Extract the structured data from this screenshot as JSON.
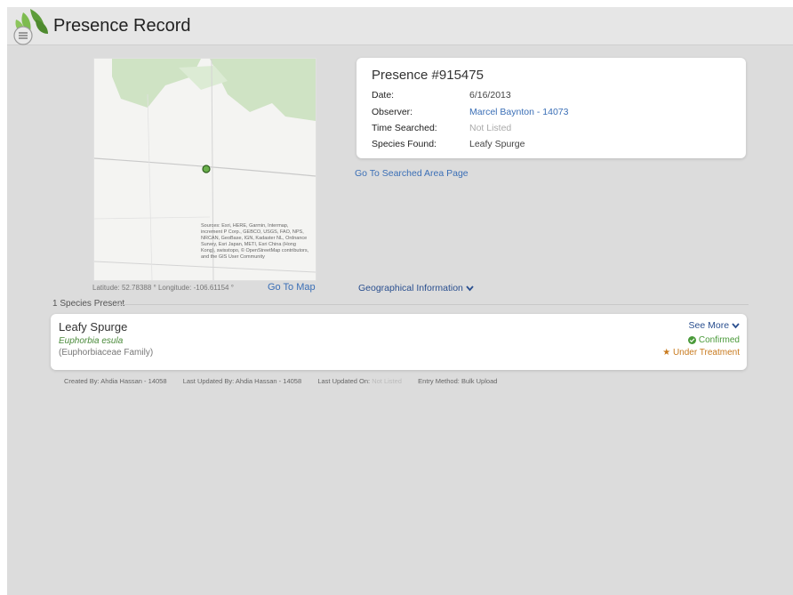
{
  "header": {
    "title": "Presence Record",
    "logo": "leaf-menu-icon"
  },
  "map": {
    "attribution": "Sources: Esri, HERE, Garmin, Intermap, increment P Corp., GEBCO, USGS, FAO, NPS, NRCAN, GeoBase, IGN, Kadaster NL, Ordnance Survey, Esri Japan, METI, Esri China (Hong Kong), swisstopo, © OpenStreetMap contributors, and the GIS User Community",
    "latitude_label": "Latitude:",
    "latitude_value": "52.78388 °",
    "longitude_label": "Longitude:",
    "longitude_value": "-106.61154 °",
    "go_to_map": "Go To Map",
    "marker_icon": "location-dot-icon"
  },
  "record": {
    "title": "Presence #915475",
    "fields": [
      {
        "label": "Date:",
        "value": "6/16/2013"
      },
      {
        "label": "Observer:",
        "value": "Marcel Baynton - 14073"
      },
      {
        "label": "Time Searched:",
        "value": "Not Listed"
      },
      {
        "label": "Species Found:",
        "value": "Leafy Spurge"
      }
    ]
  },
  "links": {
    "searched_area": "Go To Searched Area Page",
    "geographical_info": "Geographical Information"
  },
  "species_section": {
    "heading": "1 Species Present",
    "items": [
      {
        "common_name": "Leafy Spurge",
        "scientific_name": "Euphorbia esula",
        "family": "(Euphorbiaceae Family)",
        "see_more": "See More",
        "status_confirmed": "Confirmed",
        "status_treatment": "Under Treatment"
      }
    ]
  },
  "footer": {
    "created_by_label": "Created By:",
    "created_by_value": "Ahdia Hassan - 14058",
    "updated_by_label": "Last Updated By:",
    "updated_by_value": "Ahdia Hassan - 14058",
    "updated_on_label": "Last Updated On:",
    "updated_on_value": "Not Listed",
    "entry_method_label": "Entry Method:",
    "entry_method_value": "Bulk Upload"
  },
  "colors": {
    "link": "#3b6fb6",
    "confirmed": "#4a9a3a",
    "treatment": "#c87a1e",
    "map_marker": "#6ab04c"
  }
}
